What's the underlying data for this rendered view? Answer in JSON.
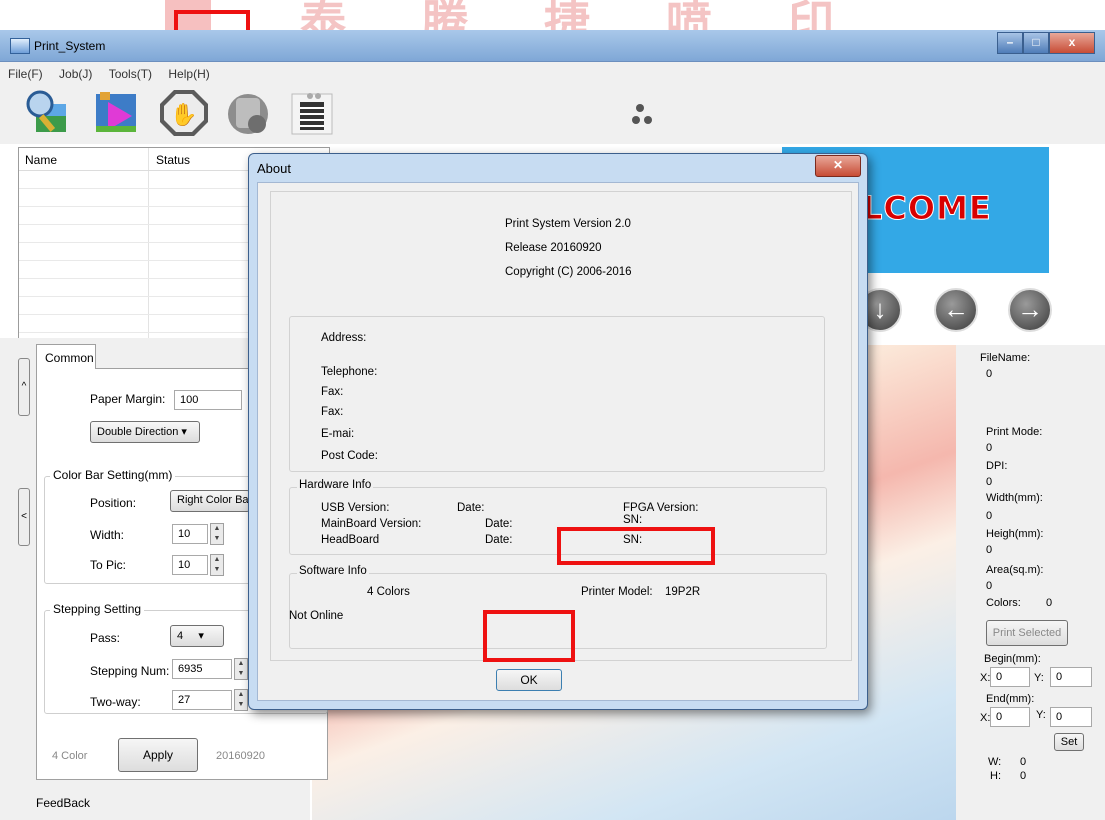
{
  "banner": {
    "glyphs": "泰 腾 捷 喷 印"
  },
  "window": {
    "title": "Print_System",
    "min": "–",
    "max": "□",
    "close": "x"
  },
  "menu": [
    "File(F)",
    "Job(J)",
    "Tools(T)",
    "Help(H)"
  ],
  "toolbar": {
    "icons": [
      "search-image-icon",
      "open-file-icon",
      "stop-hand-icon",
      "print-device-icon",
      "status-list-icon",
      "water-drops-icon"
    ]
  },
  "filelist": {
    "columns": [
      "Name",
      "Status"
    ]
  },
  "leftpanel": {
    "tab": "Common",
    "paper_margin_label": "Paper Margin:",
    "paper_margin": "100",
    "direction": "Double Direction",
    "colorbar_group": "Color Bar Setting(mm)",
    "position_label": "Position:",
    "position": "Right Color Ba",
    "width_label": "Width:",
    "width": "10",
    "topic_label": "To Pic:",
    "topic": "10",
    "stepping_group": "Stepping Setting",
    "pass_label": "Pass:",
    "pass": "4",
    "stepping_num_label": "Stepping Num:",
    "stepping_num": "6935",
    "twoway_label": "Two-way:",
    "twoway": "27",
    "colors": "4 Color",
    "apply": "Apply",
    "version": "20160920",
    "feedback": "FeedBack"
  },
  "welcome": {
    "text": "LCOME"
  },
  "nav": {
    "down": "↓",
    "left": "←",
    "right": "→"
  },
  "info": {
    "filename_label": "FileName:",
    "filename": "0",
    "printmode_label": "Print Mode:",
    "printmode": "0",
    "dpi_label": "DPI:",
    "dpi": "0",
    "width_label": "Width(mm):",
    "width": "0",
    "heigh_label": "Heigh(mm):",
    "heigh": "0",
    "area_label": "Area(sq.m):",
    "area": "0",
    "colors_label": "Colors:",
    "colors": "0",
    "print_selected": "Print Selected",
    "begin_label": "Begin(mm):",
    "begin_x_label": "X:",
    "begin_x": "0",
    "begin_y_label": "Y:",
    "begin_y": "0",
    "end_label": "End(mm):",
    "end_x_label": "X:",
    "end_x": "0",
    "end_y_label": "Y:",
    "end_y": "0",
    "set": "Set",
    "w_label": "W:",
    "w": "0",
    "h_label": "H:",
    "h": "0"
  },
  "about": {
    "title": "About",
    "version": "Print System Version 2.0",
    "release": "Release 20160920",
    "copyright": "Copyright (C) 2006-2016",
    "address": "Address:",
    "telephone": "Telephone:",
    "fax1": "Fax:",
    "fax2": "Fax:",
    "email": "E-mai:",
    "postcode": "Post Code:",
    "hardware_title": "Hardware Info",
    "usb_version": "USB Version:",
    "date1": "Date:",
    "fpga_version": "FPGA Version:",
    "mainboard_version": "MainBoard Version:",
    "date2": "Date:",
    "sn1": "SN:",
    "headboard": "HeadBoard",
    "date3": "Date:",
    "sn2": "SN:",
    "software_title": "Software Info",
    "colors": "4 Colors",
    "printer_model_label": "Printer Model:",
    "printer_model": "19P2R",
    "online_status": "Not Online",
    "ok": "OK"
  }
}
